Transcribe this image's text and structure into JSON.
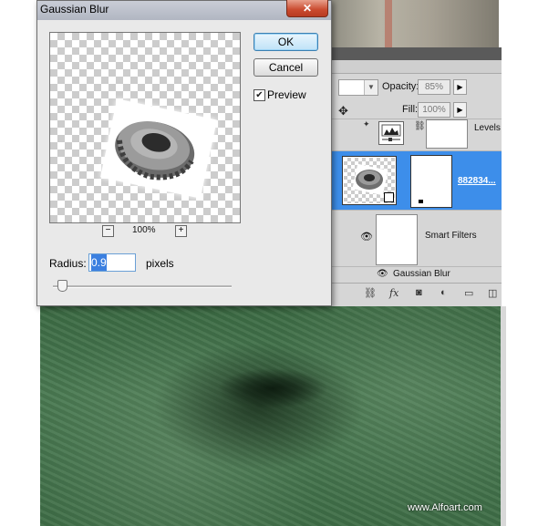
{
  "dialog": {
    "title": "Gaussian Blur",
    "close_glyph": "✕",
    "ok_label": "OK",
    "cancel_label": "Cancel",
    "preview_label": "Preview",
    "preview_checked": true,
    "zoom_minus": "−",
    "zoom_plus": "+",
    "zoom_level": "100%",
    "radius_label": "Radius:",
    "radius_value": "0.9",
    "radius_unit": "pixels"
  },
  "layers": {
    "opacity_label": "Opacity:",
    "opacity_value": "85%",
    "fill_label": "Fill:",
    "fill_value": "100%",
    "items": [
      {
        "name": "Levels"
      },
      {
        "name": "882834..."
      },
      {
        "name": "Smart Filters"
      },
      {
        "name": "Gaussian Blur"
      }
    ]
  },
  "watermark": "www.Alfoart.com",
  "icons": {
    "lock": "move-lock-icon",
    "eye": "eye-icon",
    "link": "link-icon",
    "fx": "fx-icon",
    "mask": "mask-icon",
    "adjustment": "adjustment-icon",
    "folder": "folder-icon",
    "new_layer": "new-layer-icon"
  },
  "colors": {
    "selection": "#3d8eea",
    "close_button": "#c94a2e",
    "water": "#4a7a52"
  }
}
